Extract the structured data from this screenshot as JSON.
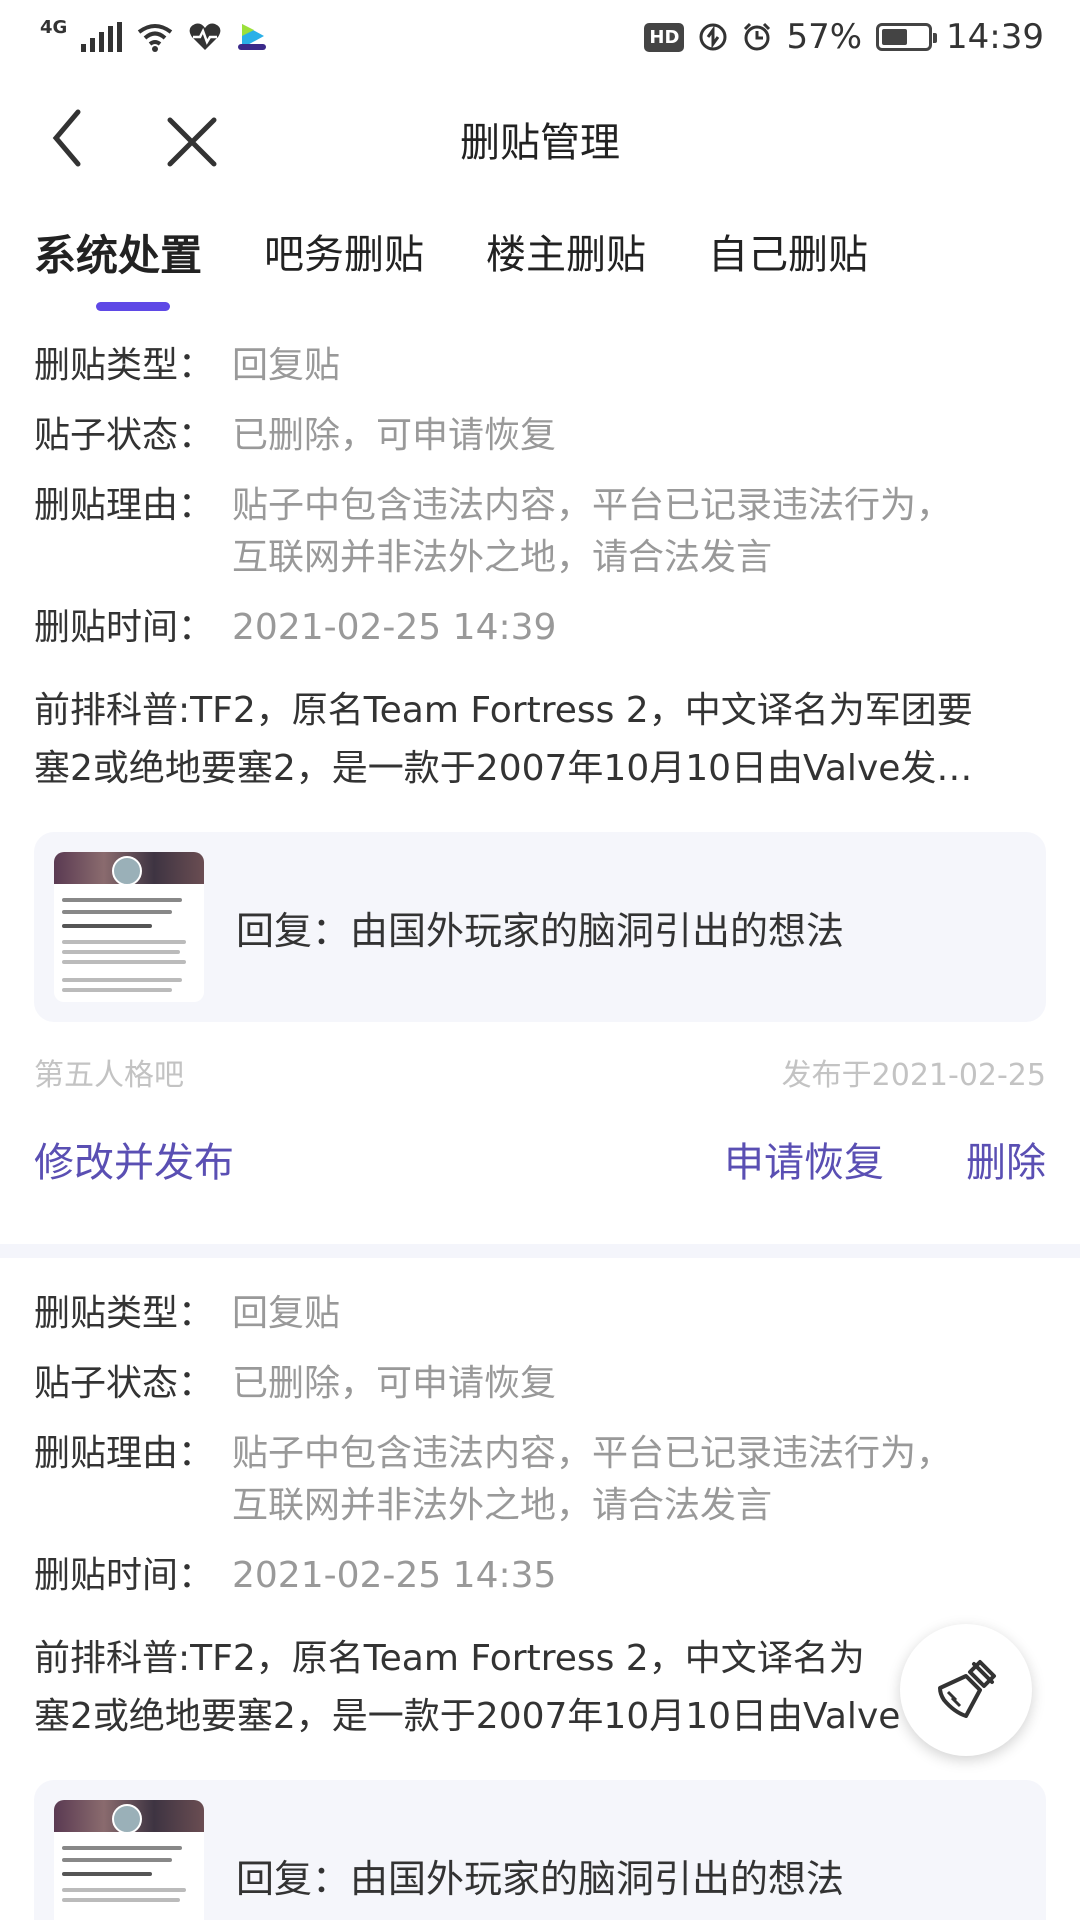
{
  "status_bar": {
    "network": "4G",
    "battery_percent": "57%",
    "battery_level": 0.57,
    "time": "14:39",
    "hd_badge": "HD",
    "icons": [
      "signal-icon",
      "wifi-icon",
      "health-icon",
      "video-app-icon",
      "hd-icon",
      "data-saver-icon",
      "alarm-icon",
      "battery-icon"
    ]
  },
  "header": {
    "title": "删贴管理",
    "back_icon": "back-icon",
    "close_icon": "close-icon"
  },
  "tabs": [
    {
      "label": "系统处置",
      "active": true
    },
    {
      "label": "吧务删贴",
      "active": false
    },
    {
      "label": "楼主删贴",
      "active": false
    },
    {
      "label": "自己删贴",
      "active": false
    }
  ],
  "posts": [
    {
      "type_label": "删贴类型：",
      "type_value": "回复贴",
      "status_label": "贴子状态：",
      "status_value": "已删除，可申请恢复",
      "reason_label": "删贴理由：",
      "reason_line1": "贴子中包含违法内容，平台已记录违法行为，",
      "reason_line2": "互联网并非法外之地，请合法发言",
      "time_label": "删贴时间：",
      "time_value": "2021-02-25 14:39",
      "summary_line1": "前排科普:TF2，原名Team Fortress 2，中文译名为军团要",
      "summary_line2": "塞2或绝地要塞2，是一款于2007年10月10日由Valve发…",
      "quote_text": "回复：由国外玩家的脑洞引出的想法",
      "forum": "第五人格吧",
      "published": "发布于2021-02-25",
      "action_edit": "修改并发布",
      "action_restore": "申请恢复",
      "action_delete": "删除"
    },
    {
      "type_label": "删贴类型：",
      "type_value": "回复贴",
      "status_label": "贴子状态：",
      "status_value": "已删除，可申请恢复",
      "reason_label": "删贴理由：",
      "reason_line1": "贴子中包含违法内容，平台已记录违法行为，",
      "reason_line2": "互联网并非法外之地，请合法发言",
      "time_label": "删贴时间：",
      "time_value": "2021-02-25 14:35",
      "summary_line1": "前排科普:TF2，原名Team Fortress 2，中文译名为",
      "summary_line2": "塞2或绝地要塞2，是一款于2007年10月10日由Valve",
      "quote_text": "回复：由国外玩家的脑洞引出的想法"
    }
  ],
  "fab": {
    "icon": "brush-icon"
  },
  "colors": {
    "accent": "#5f49e6",
    "action": "#5a4fb3",
    "muted": "#999999",
    "card_bg": "#f5f6fb"
  }
}
